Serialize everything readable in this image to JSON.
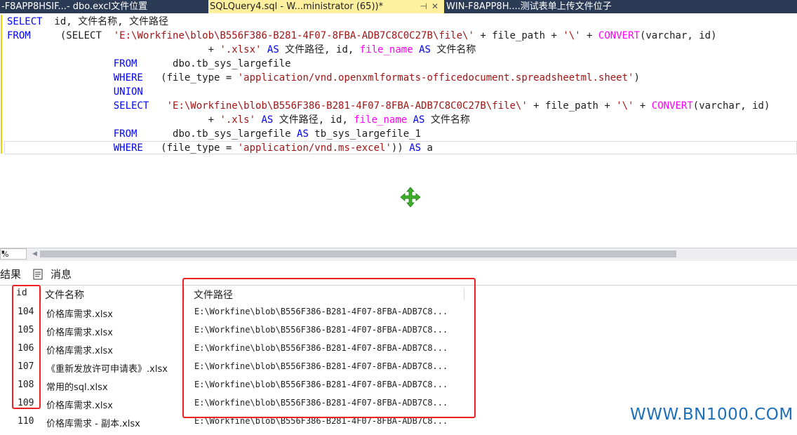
{
  "tabs": [
    {
      "label": "-F8APP8HSIF...- dbo.excl文件位置",
      "active": false
    },
    {
      "label": "SQLQuery4.sql - W...ministrator (65))*",
      "active": true
    },
    {
      "label": "WIN-F8APP8H....测试表单上传文件位子",
      "active": false
    }
  ],
  "tab_pin_icon": "pin-icon",
  "tab_close_icon": "close-icon",
  "editor": {
    "lines": [
      {
        "parts": [
          [
            "kw",
            "SELECT"
          ],
          [
            "txt",
            "  id, 文件名称, 文件路径"
          ]
        ]
      },
      {
        "parts": [
          [
            "kw",
            "FROM"
          ],
          [
            "txt",
            "     "
          ],
          [
            "txt",
            "(SELECT  "
          ],
          [
            "str",
            "'E:\\Workfine\\blob\\B556F386-B281-4F07-8FBA-ADB7C8C0C27B\\file\\'"
          ],
          [
            "txt",
            " + file_path + "
          ],
          [
            "str",
            "'\\'"
          ],
          [
            "txt",
            " + "
          ],
          [
            "fn",
            "CONVERT"
          ],
          [
            "txt",
            "(varchar, id)"
          ]
        ]
      },
      {
        "parts": [
          [
            "txt",
            "                                  + "
          ],
          [
            "str",
            "'.xlsx'"
          ],
          [
            "txt",
            " "
          ],
          [
            "kw",
            "AS"
          ],
          [
            "txt",
            " 文件路径, id, "
          ],
          [
            "fn",
            "file_name"
          ],
          [
            "txt",
            " "
          ],
          [
            "kw",
            "AS"
          ],
          [
            "txt",
            " 文件名称"
          ]
        ]
      },
      {
        "parts": [
          [
            "txt",
            "                  "
          ],
          [
            "kw",
            "FROM"
          ],
          [
            "txt",
            "      dbo.tb_sys_largefile"
          ]
        ]
      },
      {
        "parts": [
          [
            "txt",
            "                  "
          ],
          [
            "kw",
            "WHERE"
          ],
          [
            "txt",
            "   (file_type = "
          ],
          [
            "str",
            "'application/vnd.openxmlformats-officedocument.spreadsheetml.sheet'"
          ],
          [
            "txt",
            ")"
          ]
        ]
      },
      {
        "parts": [
          [
            "txt",
            "                  "
          ],
          [
            "kw",
            "UNION"
          ]
        ]
      },
      {
        "parts": [
          [
            "txt",
            "                  "
          ],
          [
            "kw",
            "SELECT"
          ],
          [
            "txt",
            "   "
          ],
          [
            "str",
            "'E:\\Workfine\\blob\\B556F386-B281-4F07-8FBA-ADB7C8C0C27B\\file\\'"
          ],
          [
            "txt",
            " + file_path + "
          ],
          [
            "str",
            "'\\'"
          ],
          [
            "txt",
            " + "
          ],
          [
            "fn",
            "CONVERT"
          ],
          [
            "txt",
            "(varchar, id)"
          ]
        ]
      },
      {
        "parts": [
          [
            "txt",
            "                                  + "
          ],
          [
            "str",
            "'.xls'"
          ],
          [
            "txt",
            " "
          ],
          [
            "kw",
            "AS"
          ],
          [
            "txt",
            " 文件路径, id, "
          ],
          [
            "fn",
            "file_name"
          ],
          [
            "txt",
            " "
          ],
          [
            "kw",
            "AS"
          ],
          [
            "txt",
            " 文件名称"
          ]
        ]
      },
      {
        "parts": [
          [
            "txt",
            "                  "
          ],
          [
            "kw",
            "FROM"
          ],
          [
            "txt",
            "      dbo.tb_sys_largefile "
          ],
          [
            "kw",
            "AS"
          ],
          [
            "txt",
            " tb_sys_largefile_1"
          ]
        ]
      },
      {
        "parts": [
          [
            "txt",
            "                  "
          ],
          [
            "kw",
            "WHERE"
          ],
          [
            "txt",
            "   (file_type = "
          ],
          [
            "str",
            "'application/vnd.ms-excel'"
          ],
          [
            "txt",
            ")) "
          ],
          [
            "kw",
            "AS"
          ],
          [
            "txt",
            " a"
          ]
        ]
      }
    ]
  },
  "move_cursor_icon": "move-cursor-icon",
  "zoom": {
    "value": "%",
    "arrow_icon": "dropdown-arrow-icon"
  },
  "scroll_left_icon": "scroll-left-arrow-icon",
  "result_tabs": {
    "results": "结果",
    "messages": "消息",
    "messages_icon": "messages-icon"
  },
  "grid": {
    "columns": [
      "id",
      "文件名称",
      "文件路径"
    ],
    "rows": [
      {
        "id": "104",
        "name": "价格库需求.xlsx",
        "path": "E:\\Workfine\\blob\\B556F386-B281-4F07-8FBA-ADB7C8..."
      },
      {
        "id": "105",
        "name": "价格库需求.xlsx",
        "path": "E:\\Workfine\\blob\\B556F386-B281-4F07-8FBA-ADB7C8..."
      },
      {
        "id": "106",
        "name": "价格库需求.xlsx",
        "path": "E:\\Workfine\\blob\\B556F386-B281-4F07-8FBA-ADB7C8..."
      },
      {
        "id": "107",
        "name": "《重新发放许可申请表》.xlsx",
        "path": "E:\\Workfine\\blob\\B556F386-B281-4F07-8FBA-ADB7C8..."
      },
      {
        "id": "108",
        "name": "常用的sql.xlsx",
        "path": "E:\\Workfine\\blob\\B556F386-B281-4F07-8FBA-ADB7C8..."
      },
      {
        "id": "109",
        "name": "价格库需求.xlsx",
        "path": "E:\\Workfine\\blob\\B556F386-B281-4F07-8FBA-ADB7C8..."
      },
      {
        "id": "110",
        "name": "价格库需求 - 副本.xlsx",
        "path": "E:\\Workfine\\blob\\B556F386-B281-4F07-8FBA-ADB7C8..."
      }
    ]
  },
  "highlight_color": "#ee2222",
  "watermark": "WWW.BN1000.COM"
}
